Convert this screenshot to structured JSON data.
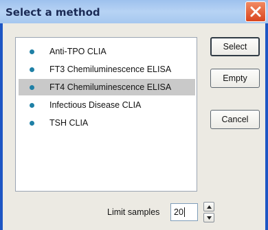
{
  "window": {
    "title": "Select a method"
  },
  "methods": {
    "items": [
      {
        "label": "Anti-TPO CLIA",
        "selected": false
      },
      {
        "label": "FT3 Chemiluminescence ELISA",
        "selected": false
      },
      {
        "label": "FT4 Chemiluminescence ELISA",
        "selected": true
      },
      {
        "label": "Infectious Disease CLIA",
        "selected": false
      },
      {
        "label": "TSH CLIA",
        "selected": false
      }
    ]
  },
  "buttons": {
    "select_label": "Select",
    "empty_label": "Empty",
    "cancel_label": "Cancel"
  },
  "limit": {
    "label": "Limit samples",
    "value": "20"
  },
  "icons": {
    "close": "close-icon",
    "bullet": "bullet-icon",
    "spin_up": "arrow-up-icon",
    "spin_down": "arrow-down-icon"
  },
  "colors": {
    "titlebar": "#b7d3f4",
    "close_button": "#d9451e",
    "bullet": "#1f80a6",
    "selection": "#c9c9c9"
  }
}
